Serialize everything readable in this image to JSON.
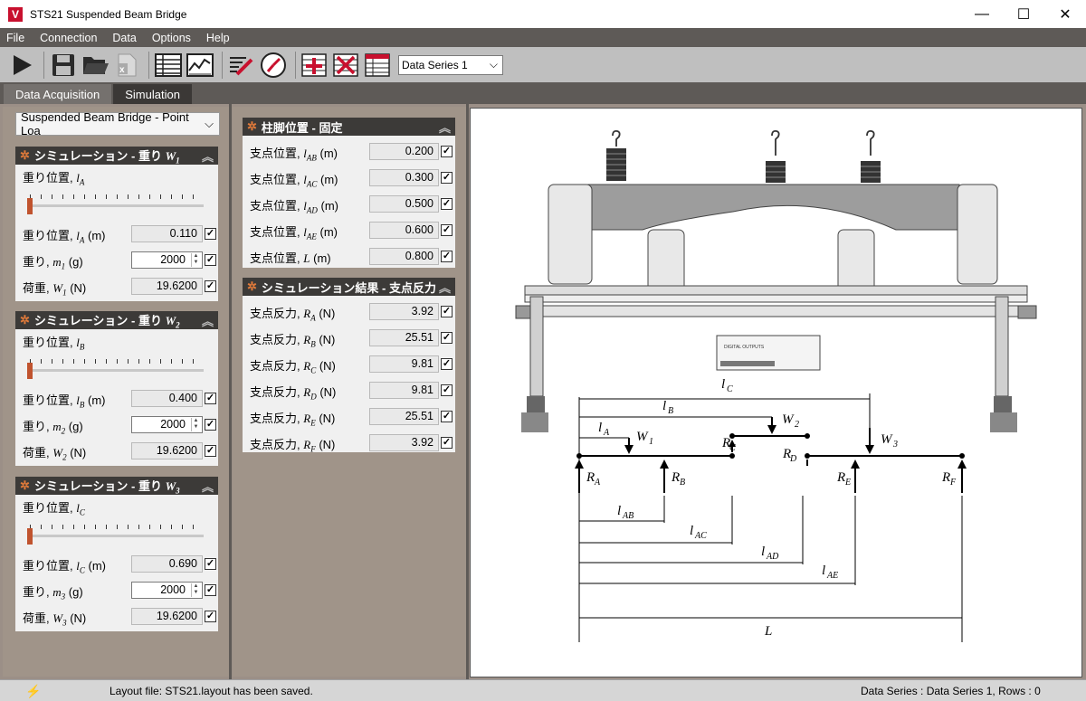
{
  "window": {
    "title": "STS21 Suspended Beam Bridge",
    "logo": "V",
    "min": "—",
    "max": "☐",
    "close": "✕"
  },
  "menu": [
    "File",
    "Connection",
    "Data",
    "Options",
    "Help"
  ],
  "toolbar": {
    "series_select": "Data Series 1",
    "icons": [
      "play-icon",
      "save-icon",
      "open-folder-icon",
      "export-excel-icon",
      "table-icon",
      "graph-icon",
      "edit-icon",
      "gauge-icon",
      "add-row-icon",
      "delete-icon",
      "table-settings-icon"
    ]
  },
  "tabs": [
    "Data Acquisition",
    "Simulation"
  ],
  "active_tab": "Simulation",
  "model_select": "Suspended Beam Bridge - Point Loa",
  "weights": [
    {
      "header": "シミュレーション - 重り",
      "header_sym": "W",
      "header_sub": "1",
      "slider_label": "重り位置,",
      "slider_sym": "l",
      "slider_sub": "A",
      "slider_fraction": 0.0,
      "rows": [
        {
          "label": "重り位置,",
          "sym": "l",
          "sub": "A",
          "unit": "(m)",
          "value": "0.110",
          "editable": false
        },
        {
          "label": "重り,",
          "sym": "m",
          "sub": "1",
          "unit": "(g)",
          "value": "2000",
          "editable": true
        },
        {
          "label": "荷重,",
          "sym": "W",
          "sub": "1",
          "unit": "(N)",
          "value": "19.6200",
          "editable": false
        }
      ]
    },
    {
      "header": "シミュレーション - 重り",
      "header_sym": "W",
      "header_sub": "2",
      "slider_label": "重り位置,",
      "slider_sym": "l",
      "slider_sub": "B",
      "slider_fraction": 0.0,
      "rows": [
        {
          "label": "重り位置,",
          "sym": "l",
          "sub": "B",
          "unit": "(m)",
          "value": "0.400",
          "editable": false
        },
        {
          "label": "重り,",
          "sym": "m",
          "sub": "2",
          "unit": "(g)",
          "value": "2000",
          "editable": true
        },
        {
          "label": "荷重,",
          "sym": "W",
          "sub": "2",
          "unit": "(N)",
          "value": "19.6200",
          "editable": false
        }
      ]
    },
    {
      "header": "シミュレーション - 重り",
      "header_sym": "W",
      "header_sub": "3",
      "slider_label": "重り位置,",
      "slider_sym": "l",
      "slider_sub": "C",
      "slider_fraction": 0.0,
      "rows": [
        {
          "label": "重り位置,",
          "sym": "l",
          "sub": "C",
          "unit": "(m)",
          "value": "0.690",
          "editable": false
        },
        {
          "label": "重り,",
          "sym": "m",
          "sub": "3",
          "unit": "(g)",
          "value": "2000",
          "editable": true
        },
        {
          "label": "荷重,",
          "sym": "W",
          "sub": "3",
          "unit": "(N)",
          "value": "19.6200",
          "editable": false
        }
      ]
    }
  ],
  "supports": {
    "header": "柱脚位置 - 固定",
    "rows": [
      {
        "label": "支点位置,",
        "sym": "l",
        "sub": "AB",
        "unit": "(m)",
        "value": "0.200"
      },
      {
        "label": "支点位置,",
        "sym": "l",
        "sub": "AC",
        "unit": "(m)",
        "value": "0.300"
      },
      {
        "label": "支点位置,",
        "sym": "l",
        "sub": "AD",
        "unit": "(m)",
        "value": "0.500"
      },
      {
        "label": "支点位置,",
        "sym": "l",
        "sub": "AE",
        "unit": "(m)",
        "value": "0.600"
      },
      {
        "label": "支点位置,",
        "sym": "L",
        "sub": "",
        "unit": "(m)",
        "value": "0.800"
      }
    ]
  },
  "reactions": {
    "header": "シミュレーション結果 - 支点反力",
    "rows": [
      {
        "label": "支点反力,",
        "sym": "R",
        "sub": "A",
        "unit": "(N)",
        "value": "3.92"
      },
      {
        "label": "支点反力,",
        "sym": "R",
        "sub": "B",
        "unit": "(N)",
        "value": "25.51"
      },
      {
        "label": "支点反力,",
        "sym": "R",
        "sub": "C",
        "unit": "(N)",
        "value": "9.81"
      },
      {
        "label": "支点反力,",
        "sym": "R",
        "sub": "D",
        "unit": "(N)",
        "value": "9.81"
      },
      {
        "label": "支点反力,",
        "sym": "R",
        "sub": "E",
        "unit": "(N)",
        "value": "25.51"
      },
      {
        "label": "支点反力,",
        "sym": "R",
        "sub": "F",
        "unit": "(N)",
        "value": "3.92"
      }
    ]
  },
  "apparatus": {
    "panel_label": "DIGITAL OUTPUTS"
  },
  "status": {
    "message": "Layout file: STS21.layout has been saved.",
    "right": "Data Series : Data Series 1,  Rows : 0"
  },
  "colors": {
    "menu_bg": "#5e5a57",
    "panel_header": "#3c3a38",
    "slider_thumb": "#c0532e",
    "arrow": "#c0532e"
  }
}
